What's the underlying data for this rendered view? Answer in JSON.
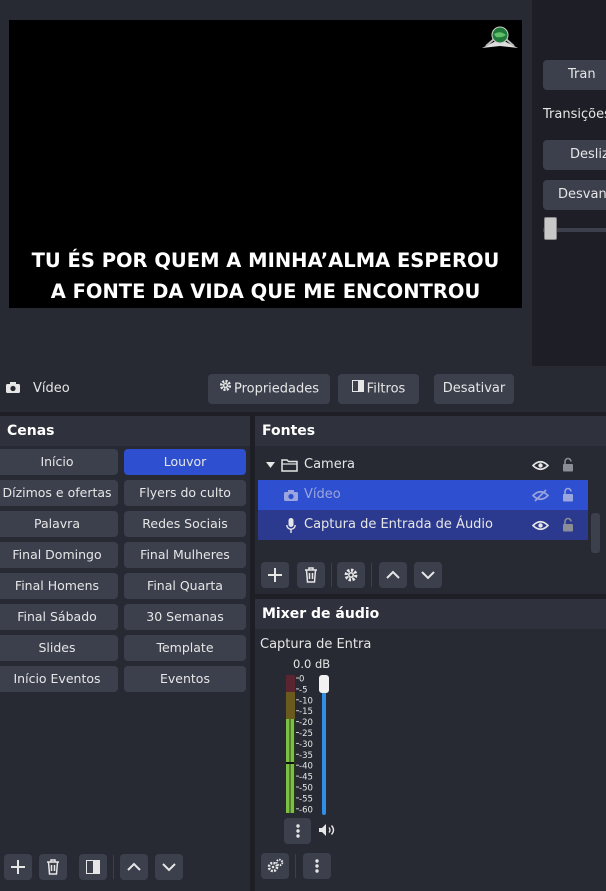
{
  "preview": {
    "lyrics_line1": "TU ÉS POR QUEM A MINHA’ALMA ESPEROU",
    "lyrics_line2": "A FONTE DA VIDA QUE ME ENCONTROU"
  },
  "transitions": {
    "button_top": "Tran",
    "label": "Transições",
    "item1": "Desliza",
    "item2": "Desvane"
  },
  "context_bar": {
    "source_name": "Vídeo",
    "properties": "Propriedades",
    "filters": "Filtros",
    "deactivate": "Desativar"
  },
  "scenes": {
    "title": "Cenas",
    "items": [
      "Início",
      "Louvor",
      "Dízimos e ofertas",
      "Flyers do culto",
      "Palavra",
      "Redes Sociais",
      "Final Domingo",
      "Final Mulheres",
      "Final Homens",
      "Final Quarta",
      "Final Sábado",
      "30 Semanas",
      "Slides",
      "Template",
      "Início Eventos",
      "Eventos"
    ],
    "active": "Louvor"
  },
  "sources": {
    "title": "Fontes",
    "group": "Camera",
    "item1": "Vídeo",
    "item2": "Captura de Entrada de Áudio"
  },
  "mixer": {
    "title": "Mixer de áudio",
    "channel_name": "Captura de Entra",
    "level": "0.0 dB",
    "ticks": [
      "0",
      "-5",
      "-10",
      "-15",
      "-20",
      "-25",
      "-30",
      "-35",
      "-40",
      "-45",
      "-50",
      "-55",
      "-60"
    ],
    "volume_fraction": 1.0
  },
  "colors": {
    "accent": "#2e4fcf",
    "button": "#3c404d",
    "panel": "#272a33"
  }
}
